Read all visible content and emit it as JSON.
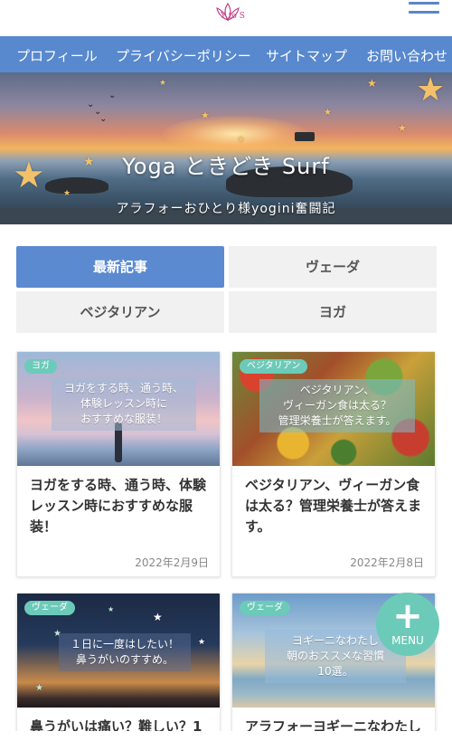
{
  "header": {
    "logo_text": "Y to S",
    "menu_icon": "hamburger-icon"
  },
  "nav": {
    "items": [
      {
        "label": "プロフィール"
      },
      {
        "label": "プライバシーポリシー"
      },
      {
        "label": "サイトマップ"
      },
      {
        "label": "お問い合わせ"
      }
    ]
  },
  "hero": {
    "title": "Yoga ときどき Surf",
    "subtitle": "アラフォーおひとり様yogini奮闘記"
  },
  "tabs": [
    {
      "label": "最新記事",
      "active": true
    },
    {
      "label": "ヴェーダ",
      "active": false
    },
    {
      "label": "ベジタリアン",
      "active": false
    },
    {
      "label": "ヨガ",
      "active": false
    }
  ],
  "cards": [
    {
      "category": "ヨガ",
      "overlay": "ヨガをする時、通う時、\n体験レッスン時に\nおすすめな服装！",
      "title": "ヨガをする時、通う時、体験レッスン時におすすめな服装！",
      "date": "2022年2月9日"
    },
    {
      "category": "ベジタリアン",
      "overlay": "ベジタリアン、\nヴィーガン食は太る？\n管理栄養士が答えます。",
      "title": "ベジタリアン、ヴィーガン食は太る？管理栄養士が答えます。",
      "date": "2022年2月8日"
    },
    {
      "category": "ヴェーダ",
      "overlay": "１日に一度はしたい！\n鼻うがいのすすめ。",
      "title": "鼻うがいは痛い？難しい？1",
      "date": ""
    },
    {
      "category": "ヴェーダ",
      "overlay": "ヨギーニなわたし\n朝のおススメな習慣\n10選。",
      "title": "アラフォーヨギーニなわたし",
      "date": ""
    }
  ],
  "fab": {
    "icon": "plus-icon",
    "label": "MENU"
  },
  "colors": {
    "nav_bg": "#5889cf",
    "tab_active": "#5b8ad0",
    "accent_mint": "#6ccab9"
  }
}
